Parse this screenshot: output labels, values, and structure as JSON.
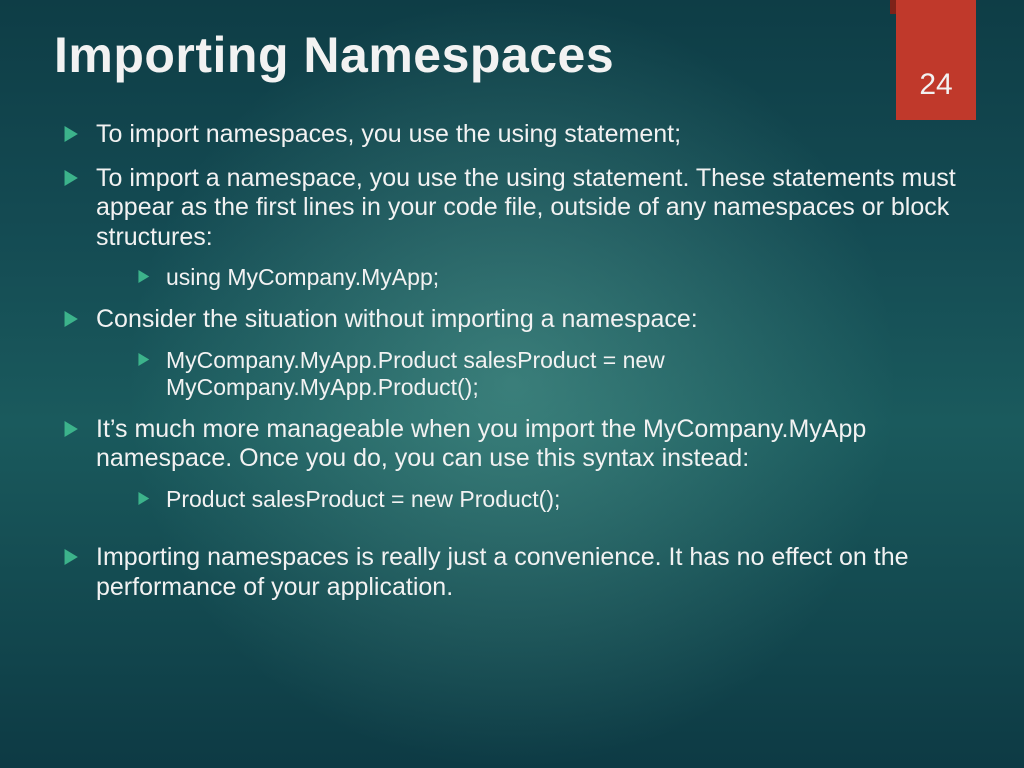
{
  "accent": "#3CB38B",
  "ribbon_color": "#C0392B",
  "page_number": "24",
  "title": "Importing Namespaces",
  "bullets": [
    {
      "text": "To import namespaces, you use the using statement;",
      "sub": []
    },
    {
      "text": "To import a namespace, you use the using statement. These statements must appear as the first lines in your code file, outside of any namespaces or block structures:",
      "sub": [
        {
          "text": "using MyCompany.MyApp;"
        }
      ]
    },
    {
      "text": "Consider the situation without importing a namespace:",
      "sub": [
        {
          "text": "MyCompany.MyApp.Product salesProduct = new MyCompany.MyApp.Product();"
        }
      ]
    },
    {
      "text": "It’s much more manageable when you import the MyCompany.MyApp namespace. Once you do, you can use this syntax instead:",
      "sub": [
        {
          "text": "Product salesProduct = new Product();"
        }
      ]
    },
    {
      "text": "Importing namespaces is really just a convenience. It has no effect on the performance of your application.",
      "gap_before": true,
      "sub": []
    }
  ]
}
